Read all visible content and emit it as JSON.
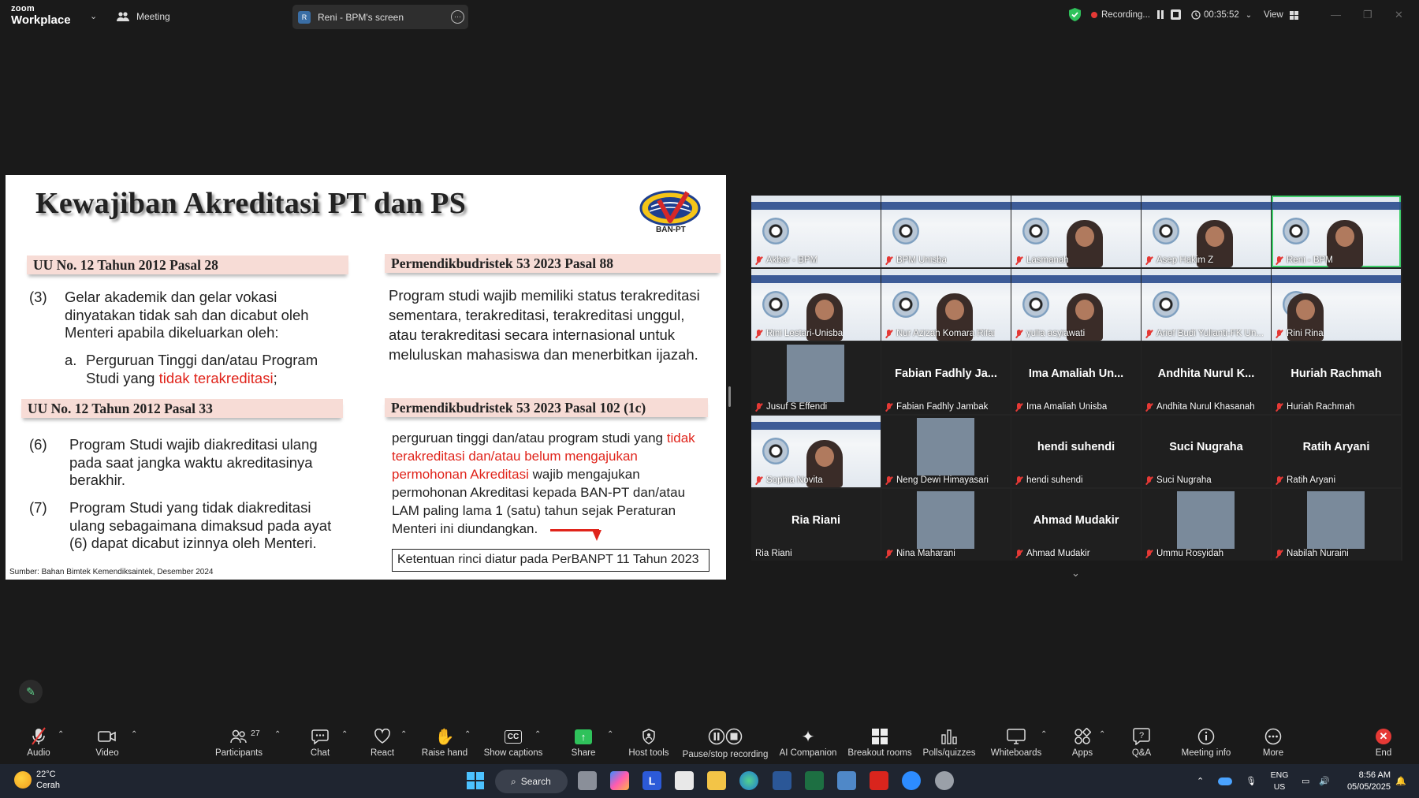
{
  "titlebar": {
    "logo_top": "zoom",
    "logo_bottom": "Workplace",
    "meeting_label": "Meeting",
    "shared_screen_avatar": "R",
    "shared_screen_label": "Reni - BPM's screen",
    "recording_label": "Recording...",
    "timer": "00:35:52",
    "view_label": "View"
  },
  "slide": {
    "title": "Kewajiban Akreditasi  PT dan PS",
    "logo_text": "BAN-PT",
    "left": {
      "heading1": "UU No. 12 Tahun 2012 Pasal 28",
      "item3_num": "(3)",
      "item3_text": "Gelar akademik dan gelar vokasi dinyatakan tidak sah dan dicabut oleh Menteri apabila dikeluarkan oleh:",
      "item3a_label": "a.",
      "item3a_pre": "Perguruan Tinggi dan/atau Program Studi yang ",
      "item3a_red": "tidak terakreditasi",
      "item3a_post": ";",
      "heading2": "UU No. 12 Tahun 2012 Pasal 33",
      "item6_num": "(6)",
      "item6_text": "Program Studi wajib diakreditasi ulang pada saat jangka waktu akreditasinya berakhir.",
      "item7_num": "(7)",
      "item7_text": "Program Studi yang tidak diakreditasi ulang sebagaimana dimaksud pada ayat (6) dapat dicabut izinnya oleh Menteri."
    },
    "right": {
      "heading1": "Permendikbudristek 53 2023 Pasal 88",
      "para1": "Program studi wajib memiliki status terakreditasi sementara, terakreditasi, terakreditasi unggul, atau terakreditasi secara internasional untuk meluluskan mahasiswa dan menerbitkan ijazah.",
      "heading2": "Permendikbudristek 53 2023 Pasal 102 (1c)",
      "para2_pre": "perguruan tinggi dan/atau program studi yang ",
      "para2_red": "tidak terakreditasi dan/atau belum mengajukan permohonan Akreditasi",
      "para2_post": " wajib mengajukan permohonan Akreditasi kepada BAN-PT dan/atau LAM paling lama 1 (satu) tahun sejak Peraturan Menteri ini diundangkan.",
      "note": "Ketentuan rinci diatur pada PerBANPT 11 Tahun 2023"
    },
    "source": "Sumber: Bahan Bimtek Kemendiksaintek, Desember 2024"
  },
  "gallery": {
    "tiles": [
      {
        "name": "Akbar - BPM",
        "type": "video"
      },
      {
        "name": "BPM Unisba",
        "type": "video"
      },
      {
        "name": "Lasmanah",
        "type": "video"
      },
      {
        "name": "Asep Hakim Z",
        "type": "video"
      },
      {
        "name": "Reni - BPM",
        "type": "video"
      },
      {
        "name": "Rini Lestari-Unisba",
        "type": "video"
      },
      {
        "name": "Nur Azizah Komara Rifai",
        "type": "video"
      },
      {
        "name": "yulia asyiawati",
        "type": "video"
      },
      {
        "name": "Arief Budi Yulianti-FK Un...",
        "type": "video"
      },
      {
        "name": "Rini Rina",
        "type": "video"
      },
      {
        "name": "Jusuf S Effendi",
        "type": "photo"
      },
      {
        "name": "Fabian Fadhly Jambak",
        "display": "Fabian Fadhly Ja...",
        "type": "text"
      },
      {
        "name": "Ima Amaliah Unisba",
        "display": "Ima Amaliah Un...",
        "type": "text"
      },
      {
        "name": "Andhita Nurul Khasanah",
        "display": "Andhita Nurul K...",
        "type": "text"
      },
      {
        "name": "Huriah Rachmah",
        "display": "Huriah Rachmah",
        "type": "text"
      },
      {
        "name": "Sophia Novita",
        "type": "video"
      },
      {
        "name": "Neng Dewi Himayasari",
        "type": "photo"
      },
      {
        "name": "hendi suhendi",
        "display": "hendi suhendi",
        "type": "text"
      },
      {
        "name": "Suci Nugraha",
        "display": "Suci Nugraha",
        "type": "text"
      },
      {
        "name": "Ratih Aryani",
        "display": "Ratih Aryani",
        "type": "text"
      },
      {
        "name": "Ria Riani",
        "display": "Ria Riani",
        "type": "text"
      },
      {
        "name": "Nina Maharani",
        "type": "photo"
      },
      {
        "name": "Ahmad Mudakir",
        "display": "Ahmad Mudakir",
        "type": "text"
      },
      {
        "name": "Ummu Rosyidah",
        "type": "photo"
      },
      {
        "name": "Nabilah Nuraini",
        "type": "photo"
      }
    ]
  },
  "toolbar": {
    "audio": "Audio",
    "video": "Video",
    "participants": "Participants",
    "participants_count": "27",
    "chat": "Chat",
    "react": "React",
    "raise_hand": "Raise hand",
    "show_captions": "Show captions",
    "share": "Share",
    "host_tools": "Host tools",
    "pause_stop_recording": "Pause/stop recording",
    "ai_companion": "AI Companion",
    "breakout_rooms": "Breakout rooms",
    "polls": "Polls/quizzes",
    "whiteboards": "Whiteboards",
    "apps": "Apps",
    "qa": "Q&A",
    "meeting_info": "Meeting info",
    "more": "More",
    "end": "End",
    "cc_icon_text": "CC"
  },
  "taskbar": {
    "temperature": "22°C",
    "weather": "Cerah",
    "search": "Search",
    "lang_top": "ENG",
    "lang_bottom": "US",
    "time": "8:56 AM",
    "date": "05/05/2025"
  }
}
